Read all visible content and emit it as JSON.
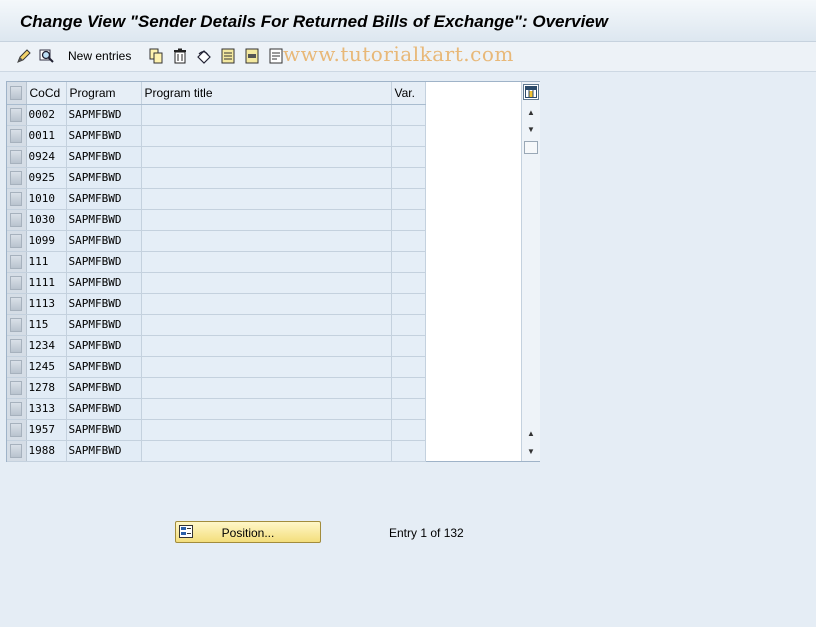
{
  "window": {
    "title": "Change View \"Sender Details For Returned Bills of Exchange\": Overview"
  },
  "watermark": "www.tutorialkart.com",
  "toolbar": {
    "items": [
      {
        "icon": "display-change-icon"
      },
      {
        "icon": "find-icon"
      },
      {
        "label": "New entries"
      },
      {
        "icon": "copy-as-icon"
      },
      {
        "icon": "delete-icon"
      },
      {
        "icon": "undo-change-icon"
      },
      {
        "icon": "select-all-icon"
      },
      {
        "icon": "select-block-icon"
      },
      {
        "icon": "deselect-all-icon"
      }
    ],
    "new_entries_label": "New entries"
  },
  "table": {
    "columns": [
      "CoCd",
      "Program",
      "Program title",
      "Var."
    ],
    "rows": [
      {
        "cocd": "0002",
        "program": "SAPMFBWD",
        "title": "",
        "var": ""
      },
      {
        "cocd": "0011",
        "program": "SAPMFBWD",
        "title": "",
        "var": ""
      },
      {
        "cocd": "0924",
        "program": "SAPMFBWD",
        "title": "",
        "var": ""
      },
      {
        "cocd": "0925",
        "program": "SAPMFBWD",
        "title": "",
        "var": ""
      },
      {
        "cocd": "1010",
        "program": "SAPMFBWD",
        "title": "",
        "var": ""
      },
      {
        "cocd": "1030",
        "program": "SAPMFBWD",
        "title": "",
        "var": ""
      },
      {
        "cocd": "1099",
        "program": "SAPMFBWD",
        "title": "",
        "var": ""
      },
      {
        "cocd": "111",
        "program": "SAPMFBWD",
        "title": "",
        "var": ""
      },
      {
        "cocd": "1111",
        "program": "SAPMFBWD",
        "title": "",
        "var": ""
      },
      {
        "cocd": "1113",
        "program": "SAPMFBWD",
        "title": "",
        "var": ""
      },
      {
        "cocd": "115",
        "program": "SAPMFBWD",
        "title": "",
        "var": ""
      },
      {
        "cocd": "1234",
        "program": "SAPMFBWD",
        "title": "",
        "var": ""
      },
      {
        "cocd": "1245",
        "program": "SAPMFBWD",
        "title": "",
        "var": ""
      },
      {
        "cocd": "1278",
        "program": "SAPMFBWD",
        "title": "",
        "var": ""
      },
      {
        "cocd": "1313",
        "program": "SAPMFBWD",
        "title": "",
        "var": ""
      },
      {
        "cocd": "1957",
        "program": "SAPMFBWD",
        "title": "",
        "var": ""
      },
      {
        "cocd": "1988",
        "program": "SAPMFBWD",
        "title": "",
        "var": ""
      }
    ]
  },
  "bottom": {
    "position_button_label": "Position...",
    "entry_info": "Entry 1 of 132"
  },
  "colors": {
    "background": "#e5edf5",
    "table_cell": "#e2ecf6",
    "position_button": "#f3de7c"
  }
}
